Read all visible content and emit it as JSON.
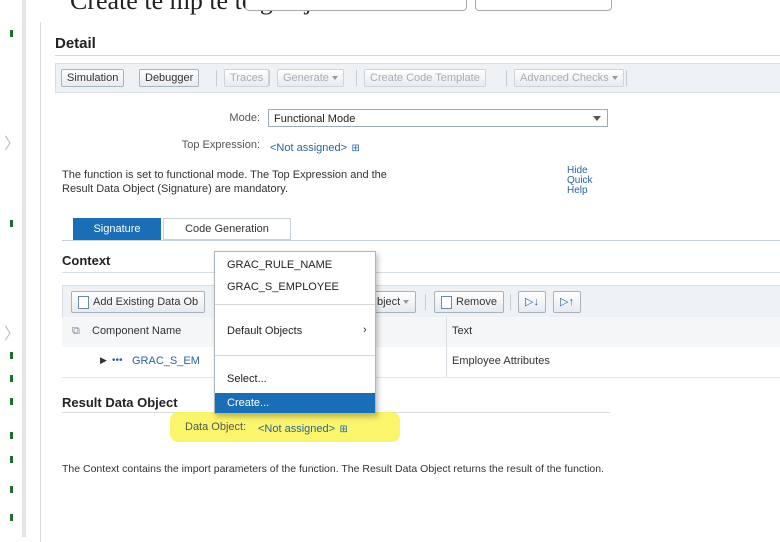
{
  "top_header": {
    "text": "Create te mp te te g te j"
  },
  "detail": {
    "title": "Detail"
  },
  "toolbar": {
    "simulation": "Simulation",
    "debugger": "Debugger",
    "traces": "Traces",
    "generate": "Generate",
    "create_code_template": "Create Code Template",
    "advanced_checks": "Advanced Checks"
  },
  "mode": {
    "label": "Mode:",
    "value": "Functional Mode"
  },
  "top_expression": {
    "label": "Top Expression:",
    "value": "<Not assigned>"
  },
  "info_text": "The function is set to functional mode. The Top Expression and the Result Data Object (Signature) are mandatory.",
  "quick_help": {
    "line1": "Hide",
    "line2": "Quick",
    "line3": "Help"
  },
  "tabs": [
    {
      "label": "Signature"
    },
    {
      "label": "Code Generation"
    }
  ],
  "context": {
    "title": "Context",
    "add_existing": "Add Existing Data Ob",
    "object_fragment": "bject",
    "remove": "Remove",
    "sort_up": "▷↓",
    "sort_down": "▷↑",
    "columns": [
      "Component Name",
      "Text"
    ],
    "rows": [
      {
        "name": "GRAC_S_EM",
        "text": "Employee Attributes"
      }
    ]
  },
  "menu": {
    "items": [
      "GRAC_RULE_NAME",
      "GRAC_S_EMPLOYEE"
    ],
    "default_objects": "Default Objects",
    "select": "Select...",
    "create": "Create..."
  },
  "result": {
    "title": "Result Data Object",
    "label": "Data Object:",
    "value": "<Not assigned>"
  },
  "footer": "The Context contains the import parameters of the function. The Result Data Object returns the result of the function.",
  "colors": {
    "accent": "#1a6eb6",
    "highlight": "#fbf45c",
    "link": "#2a62a8"
  }
}
